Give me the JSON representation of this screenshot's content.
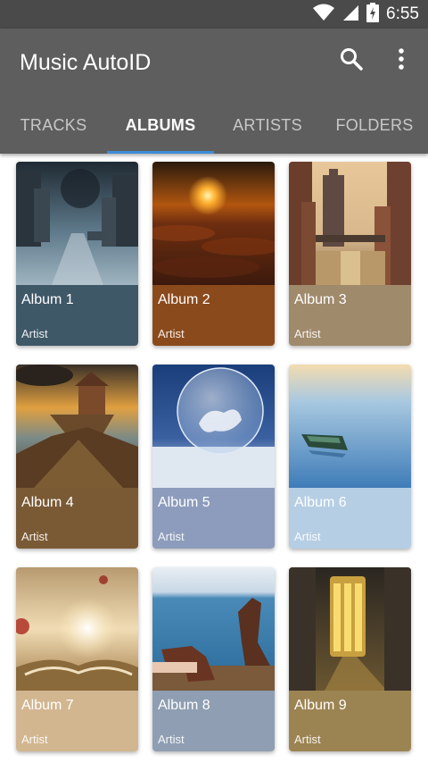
{
  "status_bar": {
    "time": "6:55",
    "icons": [
      "wifi-icon",
      "cell-signal-icon",
      "battery-charging-icon"
    ]
  },
  "app_bar": {
    "title": "Music AutoID",
    "actions": [
      {
        "icon": "search-icon"
      },
      {
        "icon": "more-vert-icon"
      }
    ]
  },
  "tabs": [
    {
      "label": "TRACKS",
      "active": false
    },
    {
      "label": "ALBUMS",
      "active": true
    },
    {
      "label": "ARTISTS",
      "active": false
    },
    {
      "label": "FOLDERS",
      "active": false
    }
  ],
  "colors": {
    "app_bar": "#5e5e5e",
    "status_bar": "#4a4a4a",
    "tab_indicator": "#3d8bd8"
  },
  "albums": [
    {
      "title": "Album 1",
      "artist": "Artist",
      "meta_color": "#3f5868"
    },
    {
      "title": "Album 2",
      "artist": "Artist",
      "meta_color": "#8b4a1c"
    },
    {
      "title": "Album 3",
      "artist": "Artist",
      "meta_color": "#a08a6c"
    },
    {
      "title": "Album 4",
      "artist": "Artist",
      "meta_color": "#7a5a34"
    },
    {
      "title": "Album 5",
      "artist": "Artist",
      "meta_color": "#8d9cbc"
    },
    {
      "title": "Album 6",
      "artist": "Artist",
      "meta_color": "#b6cee4"
    },
    {
      "title": "Album 7",
      "artist": "Artist",
      "meta_color": "#d2b690"
    },
    {
      "title": "Album 8",
      "artist": "Artist",
      "meta_color": "#8f9eb2"
    },
    {
      "title": "Album 9",
      "artist": "Artist",
      "meta_color": "#9c8452"
    }
  ]
}
